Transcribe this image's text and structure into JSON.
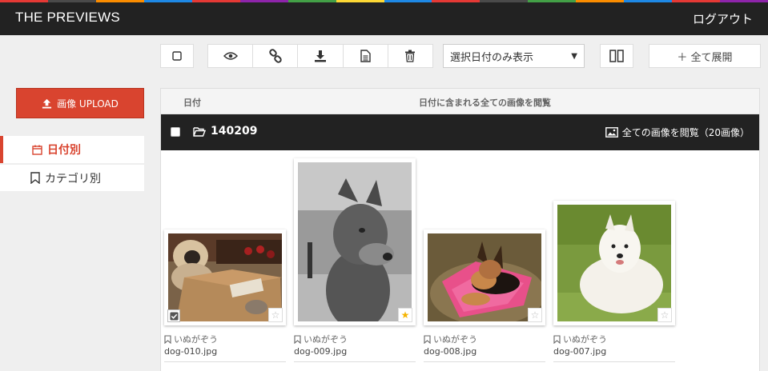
{
  "colors": {
    "strip": [
      "#e53935",
      "#4a4a4a",
      "#fb8c00",
      "#1e88e5",
      "#e53935",
      "#8e24aa",
      "#43a047",
      "#fdd835",
      "#1e88e5",
      "#e53935",
      "#4a4a4a",
      "#43a047",
      "#fb8c00",
      "#1e88e5",
      "#e53935",
      "#8e24aa"
    ],
    "accent": "#d9442f",
    "header_bg": "#222222"
  },
  "header": {
    "title": "THE PREVIEWS",
    "logout": "ログアウト"
  },
  "toolbar": {
    "icons": [
      "checkbox-icon",
      "eye-icon",
      "link-icon",
      "download-icon",
      "document-icon",
      "trash-icon",
      "split-view-icon"
    ],
    "filter_selected": "選択日付のみ表示",
    "expand_label": "＋ 全て展開"
  },
  "sidebar": {
    "upload_label": "画像 UPLOAD",
    "items": [
      {
        "label": "日付別",
        "icon": "calendar-icon",
        "active": true
      },
      {
        "label": "カテゴリ別",
        "icon": "bookmark-icon",
        "active": false
      }
    ]
  },
  "table": {
    "col_date": "日付",
    "col_view": "日付に含まれる全ての画像を閲覧"
  },
  "folder": {
    "name": "140209",
    "view_all": "全ての画像を閲覧（20画像）"
  },
  "images": [
    {
      "category": "いぬがぞう",
      "filename": "dog-010.jpg",
      "checked": true,
      "starred": false
    },
    {
      "category": "いぬがぞう",
      "filename": "dog-009.jpg",
      "checked": false,
      "starred": true
    },
    {
      "category": "いぬがぞう",
      "filename": "dog-008.jpg",
      "checked": false,
      "starred": false
    },
    {
      "category": "いぬがぞう",
      "filename": "dog-007.jpg",
      "checked": false,
      "starred": false
    }
  ]
}
